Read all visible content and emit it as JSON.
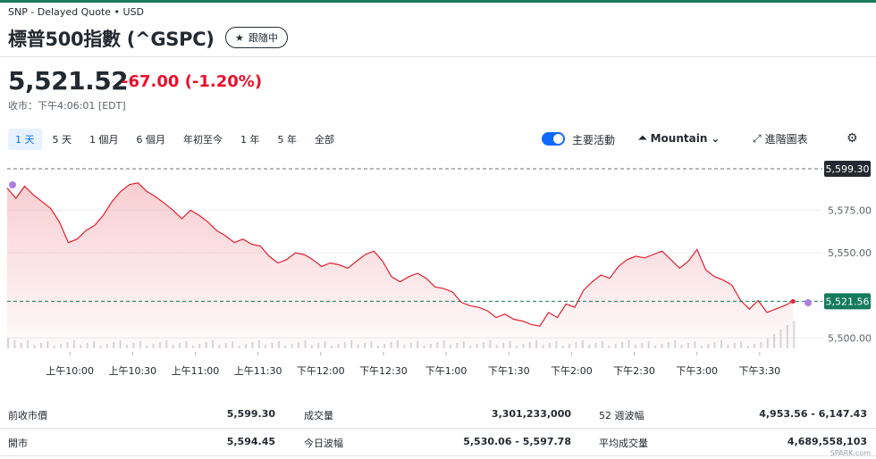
{
  "header": {
    "exchange": "SNP - Delayed Quote • USD",
    "title": "標普500指數 (^GSPC)",
    "follow_label": "跟隨中"
  },
  "quote": {
    "price": "5,521.52",
    "change": "-67.00",
    "change_pct": "(-1.20%)",
    "close_time": "收市：下午4:06:01 [EDT]"
  },
  "ranges": [
    "1 天",
    "5 天",
    "1 個月",
    "6 個月",
    "年初至今",
    "1 年",
    "5 年",
    "全部"
  ],
  "active_range": 0,
  "controls": {
    "key_events_label": "主要活動",
    "chart_type_label": "Mountain",
    "advanced_label": "進階圖表"
  },
  "colors": {
    "accent": "#0f69ff",
    "negative": "#eb0f29",
    "line": "#e0202f",
    "prev_close_badge": "#232a31",
    "current_badge": "#157a5b"
  },
  "chart_data": {
    "type": "area",
    "series": [
      {
        "values": [
          5588,
          5582,
          5589,
          5584,
          5580,
          5576,
          5568,
          5556,
          5558,
          5563,
          5566,
          5572,
          5580,
          5586,
          5590,
          5591,
          5586,
          5583,
          5579,
          5575,
          5570,
          5575,
          5572,
          5568,
          5563,
          5560,
          5556,
          5558,
          5555,
          5554,
          5548,
          5544,
          5546,
          5550,
          5549,
          5546,
          5542,
          5544,
          5543,
          5541,
          5545,
          5549,
          5551,
          5545,
          5536,
          5533,
          5536,
          5538,
          5535,
          5530,
          5529,
          5527,
          5521,
          5519,
          5518,
          5516,
          5512,
          5514,
          5511,
          5510,
          5508,
          5507,
          5515,
          5512,
          5520,
          5518,
          5528,
          5533,
          5537,
          5535,
          5542,
          5546,
          5548,
          5547,
          5549,
          5551,
          5546,
          5541,
          5545,
          5552,
          5540,
          5536,
          5534,
          5531,
          5522,
          5517,
          5522,
          5515,
          5517,
          5519,
          5521.52
        ]
      }
    ],
    "x_ticks": [
      "上午10:00",
      "上午10:30",
      "上午11:00",
      "上午11:30",
      "下午12:00",
      "下午12:30",
      "下午1:00",
      "下午1:30",
      "下午2:00",
      "下午2:30",
      "下午3:00",
      "下午3:30"
    ],
    "y_ticks": [
      "5,575.00",
      "5,550.00",
      "5,500.00"
    ],
    "y_tick_values": [
      5575,
      5550,
      5500
    ],
    "ylim": [
      5494,
      5604
    ],
    "prev_close": 5599.3,
    "prev_close_label": "5,599.30",
    "current_value": 5521.56,
    "current_label": "5,521.56",
    "session": {
      "open": "9:30",
      "close": "16:00"
    },
    "grid": true
  },
  "stats": [
    [
      {
        "label": "前收市價",
        "value": "5,599.30"
      },
      {
        "label": "成交量",
        "value": "3,301,233,000"
      },
      {
        "label": "52 週波幅",
        "value": "4,953.56 - 6,147.43"
      }
    ],
    [
      {
        "label": "開市",
        "value": "5,594.45"
      },
      {
        "label": "今日波幅",
        "value": "5,530.06 - 5,597.78"
      },
      {
        "label": "平均成交量",
        "value": "4,689,558,103"
      }
    ]
  ],
  "watermark": "SPARK.com"
}
